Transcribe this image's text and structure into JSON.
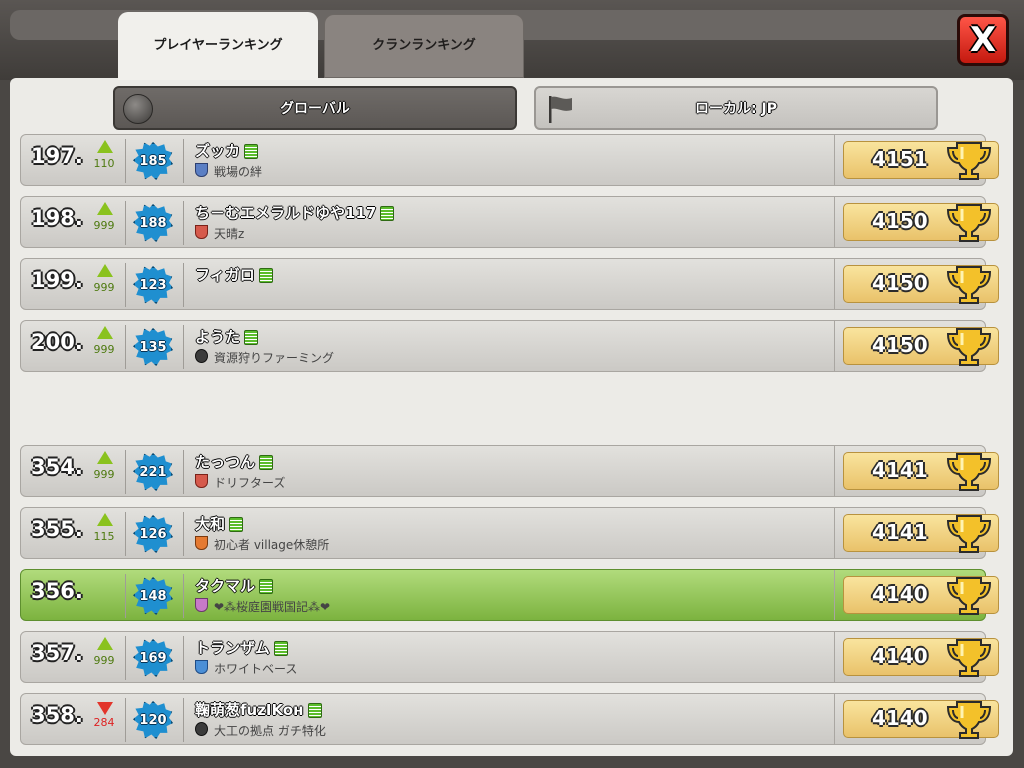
{
  "tabs": {
    "player": "プレイヤーランキング",
    "clan": "クランランキング"
  },
  "close_label": "X",
  "filters": {
    "global": "グローバル",
    "local": "ローカル: JP"
  },
  "rows": [
    {
      "rank": "197.",
      "change": "110",
      "dir": "up",
      "level": "185",
      "name": "ズッカ",
      "clan": "戦場の絆",
      "badge": "blue",
      "trophies": "4151"
    },
    {
      "rank": "198.",
      "change": "999",
      "dir": "up",
      "level": "188",
      "name": "ち－むエメラルドゆや117",
      "clan": "天晴z",
      "badge": "red",
      "trophies": "4150"
    },
    {
      "rank": "199.",
      "change": "999",
      "dir": "up",
      "level": "123",
      "name": "フィガロ",
      "clan": "",
      "badge": "",
      "trophies": "4150"
    },
    {
      "rank": "200.",
      "change": "999",
      "dir": "up",
      "level": "135",
      "name": "ようた",
      "clan": "資源狩りファーミング",
      "badge": "dark",
      "trophies": "4150"
    },
    {
      "rank": "354.",
      "change": "999",
      "dir": "up",
      "level": "221",
      "name": "たっつん",
      "clan": "ドリフターズ",
      "badge": "red",
      "trophies": "4141"
    },
    {
      "rank": "355.",
      "change": "115",
      "dir": "up",
      "level": "126",
      "name": "大和",
      "clan": "初心者 village休憩所",
      "badge": "orange",
      "trophies": "4141"
    },
    {
      "rank": "356.",
      "change": "",
      "dir": "",
      "level": "148",
      "name": "タクマル",
      "clan": "❤⁂桜庭園戦国記⁂❤",
      "badge": "pink",
      "trophies": "4140",
      "highlight": true
    },
    {
      "rank": "357.",
      "change": "999",
      "dir": "up",
      "level": "169",
      "name": "トランザム",
      "clan": "ホワイトベース",
      "badge": "blue2",
      "trophies": "4140"
    },
    {
      "rank": "358.",
      "change": "284",
      "dir": "down",
      "level": "120",
      "name": "鞠萌葱fuzIKoн",
      "clan": "大工の拠点 ガチ特化",
      "badge": "dark",
      "trophies": "4140"
    }
  ]
}
